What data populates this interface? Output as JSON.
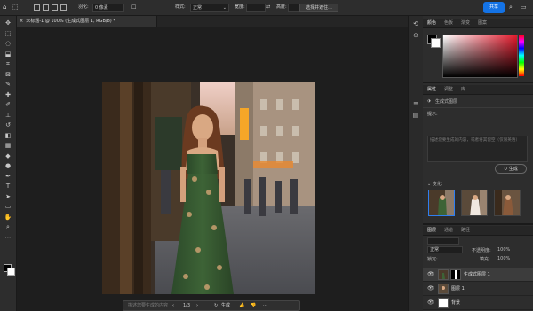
{
  "options_bar": {
    "feather_label": "羽化:",
    "feather_value": "0 像素",
    "style_label": "样式:",
    "style_value": "正常",
    "width_label": "宽度:",
    "height_label": "高度:",
    "select_mask_label": "选择并遮住..."
  },
  "share_button": "共享",
  "document_tab": {
    "title": "未标题-1 @ 100% (生成式图层 1, RGB/8) *",
    "close": "×"
  },
  "color_panel": {
    "tabs": [
      "颜色",
      "色板",
      "渐变",
      "图案"
    ],
    "active_tab": 0,
    "picked_color": "#e21a2c"
  },
  "properties_panel": {
    "tabs": [
      "属性",
      "调整",
      "库"
    ],
    "active_tab": 0,
    "layer_type": "生成式图层",
    "prompt_label": "提示:",
    "prompt_placeholder": "描述您要生成的内容，或者将其留空（仅限英语）",
    "generate_label": "生成",
    "variations_label": "变化"
  },
  "layers_panel": {
    "tabs": [
      "图层",
      "通道",
      "路径"
    ],
    "active_tab": 0,
    "blend_mode": "正常",
    "opacity_label": "不透明度:",
    "opacity_value": "100%",
    "lock_label": "锁定:",
    "fill_label": "填充:",
    "fill_value": "100%",
    "layers": [
      {
        "name": "生成式图层 1",
        "selected": true
      },
      {
        "name": "图层 1",
        "selected": false
      },
      {
        "name": "背景",
        "selected": false
      }
    ]
  },
  "contextual_bar": {
    "placeholder": "描述您要生成的内容",
    "page": "1/3",
    "generate_label": "生成"
  },
  "tools": [
    "move-icon",
    "marquee-icon",
    "lasso-icon",
    "object-select-icon",
    "crop-icon",
    "frame-icon",
    "eyedropper-icon",
    "healing-brush-icon",
    "brush-icon",
    "clone-stamp-icon",
    "history-brush-icon",
    "eraser-icon",
    "gradient-icon",
    "blur-icon",
    "dodge-icon",
    "pen-icon",
    "type-icon",
    "path-select-icon",
    "rectangle-icon",
    "hand-icon",
    "zoom-icon",
    "more-icon"
  ]
}
